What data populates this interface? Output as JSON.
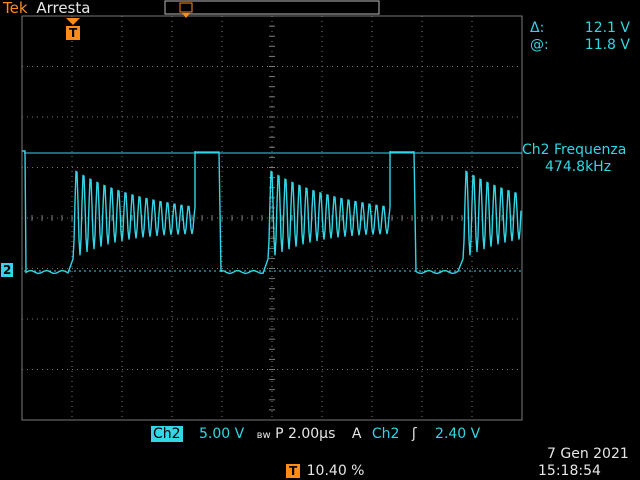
{
  "header": {
    "brand": "Tek",
    "status": "Arresta"
  },
  "cursors": {
    "delta_label": "Δ:",
    "delta_value": "12.1 V",
    "at_label": "@:",
    "at_value": "11.8 V"
  },
  "measurement": {
    "label": "Ch2 Frequenza",
    "value": "474.8kHz"
  },
  "channel_marker": "2",
  "trigger_marker": "T",
  "bottom": {
    "ch_badge": "Ch2",
    "volts_div": "5.00 V",
    "bw_symbol": "ʙw",
    "timebase": "P 2.00µs",
    "trig_mode": "A",
    "trig_source": "Ch2",
    "trig_slope": "ʃ",
    "trig_level": "2.40 V",
    "trig_pos_badge": "T",
    "trig_pos": "10.40 %"
  },
  "datetime": {
    "date": "7 Gen  2021",
    "time": "15:18:54"
  },
  "colors": {
    "trace": "#33d6e6",
    "trigger": "#ff8c1a",
    "graticule": "#7a7a7a",
    "background": "#000000"
  },
  "trace_params": {
    "freq_khz": 474.8,
    "low_v": 0,
    "high_v": 12.1,
    "volts_per_div": 5,
    "time_per_div_us": 2
  }
}
